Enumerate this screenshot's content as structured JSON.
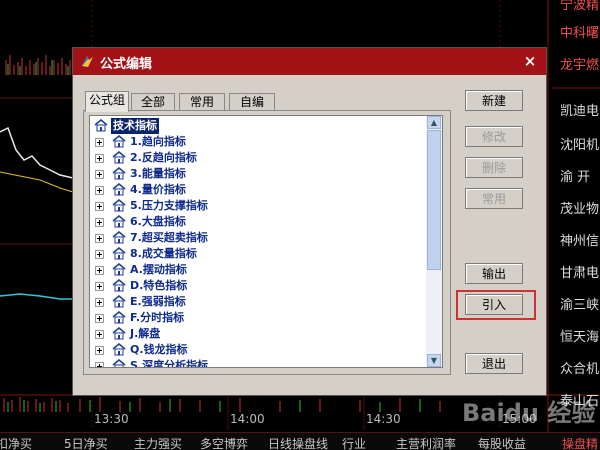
{
  "background": {
    "stocks": [
      {
        "name": "宁波精",
        "color": "red"
      },
      {
        "name": "中科曙",
        "color": "red"
      },
      {
        "name": "龙宇燃",
        "color": "red"
      },
      {
        "name": "凯迪电",
        "color": "white"
      },
      {
        "name": "沈阳机",
        "color": "white"
      },
      {
        "name": "渝 开",
        "color": "white"
      },
      {
        "name": "茂业物",
        "color": "white"
      },
      {
        "name": "神州信",
        "color": "white"
      },
      {
        "name": "甘肃电",
        "color": "white"
      },
      {
        "name": "渝三峡",
        "color": "white"
      },
      {
        "name": "恒天海",
        "color": "white"
      },
      {
        "name": "众合机",
        "color": "white"
      },
      {
        "name": "泰山石",
        "color": "white"
      }
    ],
    "times": [
      "13:30",
      "14:00",
      "14:30",
      "15:00"
    ],
    "bottom_tabs": [
      "扣净买",
      "5日净买",
      "主力强买",
      "多空博弈",
      "日线操盘线",
      "行业",
      "主营利润率",
      "每股收益",
      "操盘精"
    ]
  },
  "dialog": {
    "title": "公式编辑",
    "close_label": "×",
    "tabs": [
      "公式组",
      "全部",
      "常用",
      "自编"
    ],
    "active_tab": "公式组",
    "tree": {
      "root": "技术指标",
      "items": [
        "1.趋向指标",
        "2.反趋向指标",
        "3.能量指标",
        "4.量价指标",
        "5.压力支撑指标",
        "6.大盘指标",
        "7.超买超卖指标",
        "8.成交量指标",
        "A.摆动指标",
        "D.特色指标",
        "E.强弱指标",
        "F.分时指标",
        "J.解盘",
        "Q.钱龙指标",
        "S.深度分析指标"
      ]
    },
    "buttons": {
      "new": "新建",
      "modify": "修改",
      "delete": "删除",
      "common": "常用",
      "export": "输出",
      "import": "引入",
      "exit": "退出"
    }
  },
  "colors": {
    "titlebar": "#a21216",
    "highlight_box": "#d03030",
    "tree_text": "#102b8c",
    "selection": "#0a246a"
  },
  "watermark": "Baidu 经验"
}
